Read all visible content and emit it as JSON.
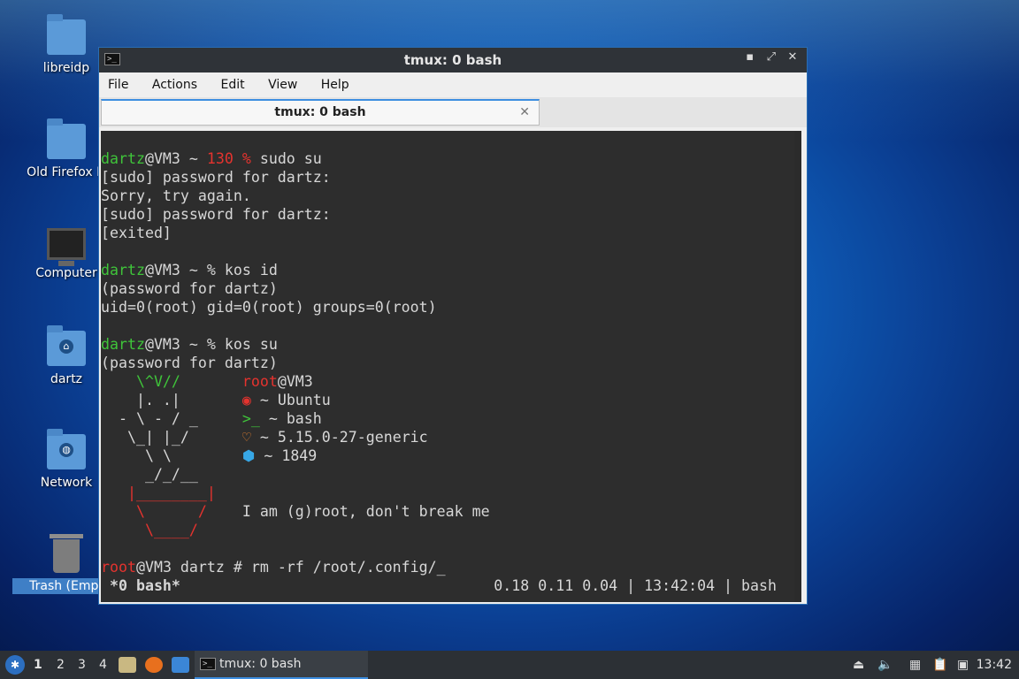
{
  "desktop": {
    "icons": [
      {
        "label": "libreidp",
        "icon": "folder-icon"
      },
      {
        "label": "Old Firefox D",
        "icon": "folder-icon"
      },
      {
        "label": "Computer",
        "icon": "monitor-icon"
      },
      {
        "label": "dartz",
        "icon": "home-folder-icon"
      },
      {
        "label": "Network",
        "icon": "network-folder-icon"
      },
      {
        "label": "Trash (Empt",
        "icon": "trash-icon"
      }
    ]
  },
  "window": {
    "title": "tmux: 0 bash",
    "controls": {
      "minimize": "▪",
      "maximize": "⤢",
      "close": "✕"
    },
    "menu": [
      "File",
      "Actions",
      "Edit",
      "View",
      "Help"
    ],
    "tab": {
      "label": "tmux: 0 bash",
      "close": "✕"
    }
  },
  "terminal": {
    "l1": {
      "user": "dartz",
      "host": "@VM3 ~ ",
      "code": "130 %",
      "cmd": " sudo su"
    },
    "l2": "[sudo] password for dartz:",
    "l3": "Sorry, try again.",
    "l4": "[sudo] password for dartz:",
    "l5": "[exited]",
    "l7": {
      "user": "dartz",
      "rest": "@VM3 ~ % kos id"
    },
    "l8": "(password for dartz)",
    "l9": "uid=0(root) gid=0(root) groups=0(root)",
    "l11": {
      "user": "dartz",
      "rest": "@VM3 ~ % kos su"
    },
    "l12": "(password for dartz)",
    "art1": "    \\^V//      ",
    "info1a": "root",
    "info1b": "@VM3",
    "art2": "    |. .|      ",
    "os_icon": "◉",
    "info2": " ~ Ubuntu",
    "art3": "  - \\ - / _    ",
    "shell_icon": ">_",
    "info3": " ~ bash",
    "art4": "   \\_| |_/     ",
    "heart_icon": "♡",
    "info4": " ~ 5.15.0-27-generic",
    "art5": "     \\ \\       ",
    "pkg_icon": "⬢",
    "info5": " ~ 1849",
    "art6": "     _/_/__",
    "art7": "   |________|",
    "art8": "    \\      /   ",
    "motd": "I am (g)root, don't break me",
    "art9": "     \\____/",
    "prompt_user": "root",
    "prompt_rest": "@VM3 dartz # rm -rf /root/.config/_",
    "status_left": " *0 bash*",
    "status_right": "0.18 0.11 0.04 | 13:42:04 | bash"
  },
  "taskbar": {
    "workspaces": [
      "1",
      "2",
      "3",
      "4"
    ],
    "task_label": "tmux: 0 bash",
    "clock": "13:42"
  }
}
